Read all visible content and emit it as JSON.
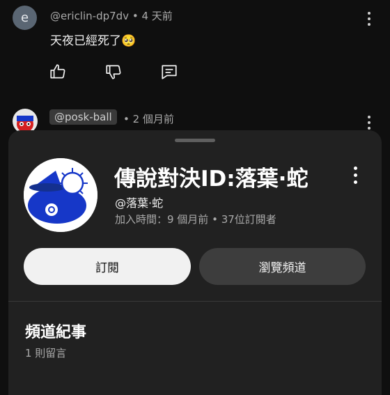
{
  "comments": [
    {
      "avatar_letter": "e",
      "author": "@ericlin-dp7dv",
      "time": "4 天前",
      "text": "天夜已經死了🥺"
    },
    {
      "author": "@posk-ball",
      "time": "2 個月前"
    }
  ],
  "actions": {
    "like_icon": "thumbs-up-icon",
    "dislike_icon": "thumbs-down-icon",
    "reply_icon": "comment-icon"
  },
  "channel_sheet": {
    "name": "傳說對決ID:落葉·蛇",
    "handle": "@落葉·蛇",
    "meta": "加入時間：9 個月前 • 37位訂閱者",
    "subscribe_label": "訂閱",
    "view_channel_label": "瀏覽頻道",
    "section_title": "頻道紀事",
    "section_subtitle": "1 則留言"
  },
  "colors": {
    "background": "#0f0f0f",
    "sheet": "#212121",
    "subscribe_button": "#f1f1f1",
    "view_button": "#3d3d3d",
    "flag_blue": "#1637c8"
  }
}
